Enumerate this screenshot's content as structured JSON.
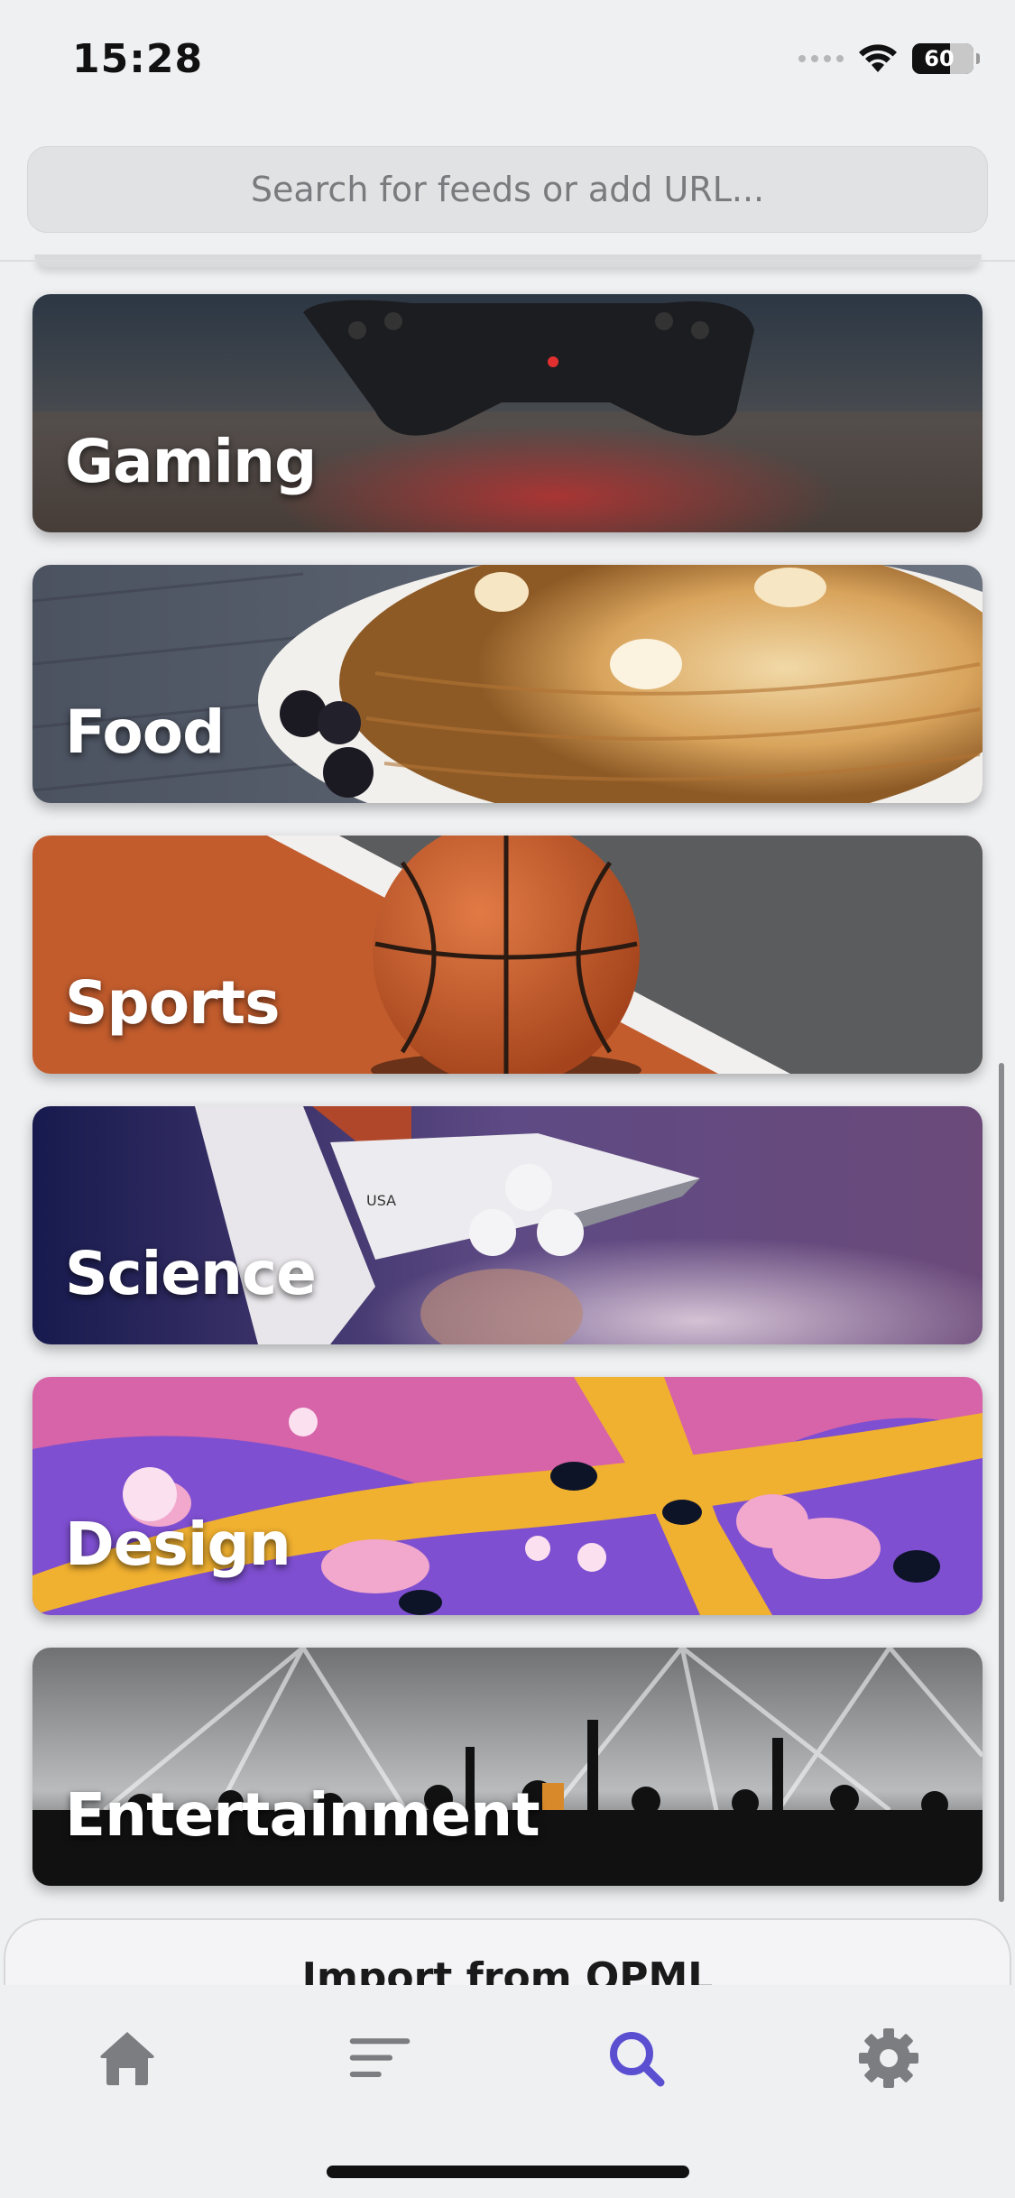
{
  "status_bar": {
    "time": "15:28",
    "battery": "60"
  },
  "search": {
    "placeholder": "Search for feeds or add URL..."
  },
  "categories": [
    {
      "label": "Gaming"
    },
    {
      "label": "Food"
    },
    {
      "label": "Sports"
    },
    {
      "label": "Science"
    },
    {
      "label": "Design"
    },
    {
      "label": "Entertainment"
    }
  ],
  "opml": {
    "label": "Import from OPML"
  },
  "tab_bar": {
    "tabs": [
      {
        "icon": "home-icon",
        "active": false
      },
      {
        "icon": "list-icon",
        "active": false
      },
      {
        "icon": "search-icon",
        "active": true
      },
      {
        "icon": "gear-icon",
        "active": false
      }
    ]
  },
  "colors": {
    "accent": "#5b4fd1",
    "inactive_icon": "#7c7d80",
    "background": "#eff0f2"
  }
}
